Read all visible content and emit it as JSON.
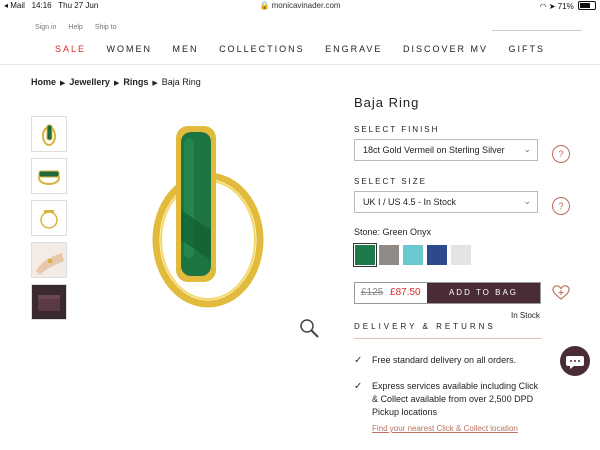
{
  "statusbar": {
    "app": "Mail",
    "time": "14:16",
    "date": "Thu 27 Jun",
    "url": "monicavinader.com",
    "battery": "71%",
    "battery_level": 0.71
  },
  "utility_links": [
    "Sign in",
    "Help",
    "Ship to"
  ],
  "nav": [
    "SALE",
    "WOMEN",
    "MEN",
    "COLLECTIONS",
    "ENGRAVE",
    "DISCOVER MV",
    "GIFTS"
  ],
  "breadcrumb": [
    "Home",
    "Jewellery",
    "Rings",
    "Baja Ring"
  ],
  "product": {
    "title": "Baja Ring",
    "finish_label": "SELECT FINISH",
    "finish_value": "18ct Gold Vermeil on Sterling Silver",
    "size_label": "SELECT SIZE",
    "size_value": "UK I / US 4.5 - In Stock",
    "help_glyph": "?",
    "stone_label": "Stone: Green Onyx",
    "swatches": [
      {
        "name": "green-onyx",
        "color": "#1f7a4a"
      },
      {
        "name": "grey-stone",
        "color": "#8f8a86"
      },
      {
        "name": "aqua-stone",
        "color": "#6cc8cf"
      },
      {
        "name": "lapis",
        "color": "#2d4a8c"
      },
      {
        "name": "white-stone",
        "color": "#e4e4e4"
      }
    ],
    "old_price": "£125",
    "new_price": "£87.50",
    "add_to_bag": "ADD TO BAG",
    "in_stock": "In Stock"
  },
  "delivery": {
    "heading": "DELIVERY & RETURNS",
    "items": [
      "Free standard delivery on all orders.",
      "Express services available including Click & Collect available from over 2,500 DPD Pickup locations"
    ],
    "link": "Find your nearest Click & Collect location"
  },
  "colors": {
    "sale": "#d62a2a",
    "brand": "#4a2c38",
    "accent": "#c06a5a"
  }
}
